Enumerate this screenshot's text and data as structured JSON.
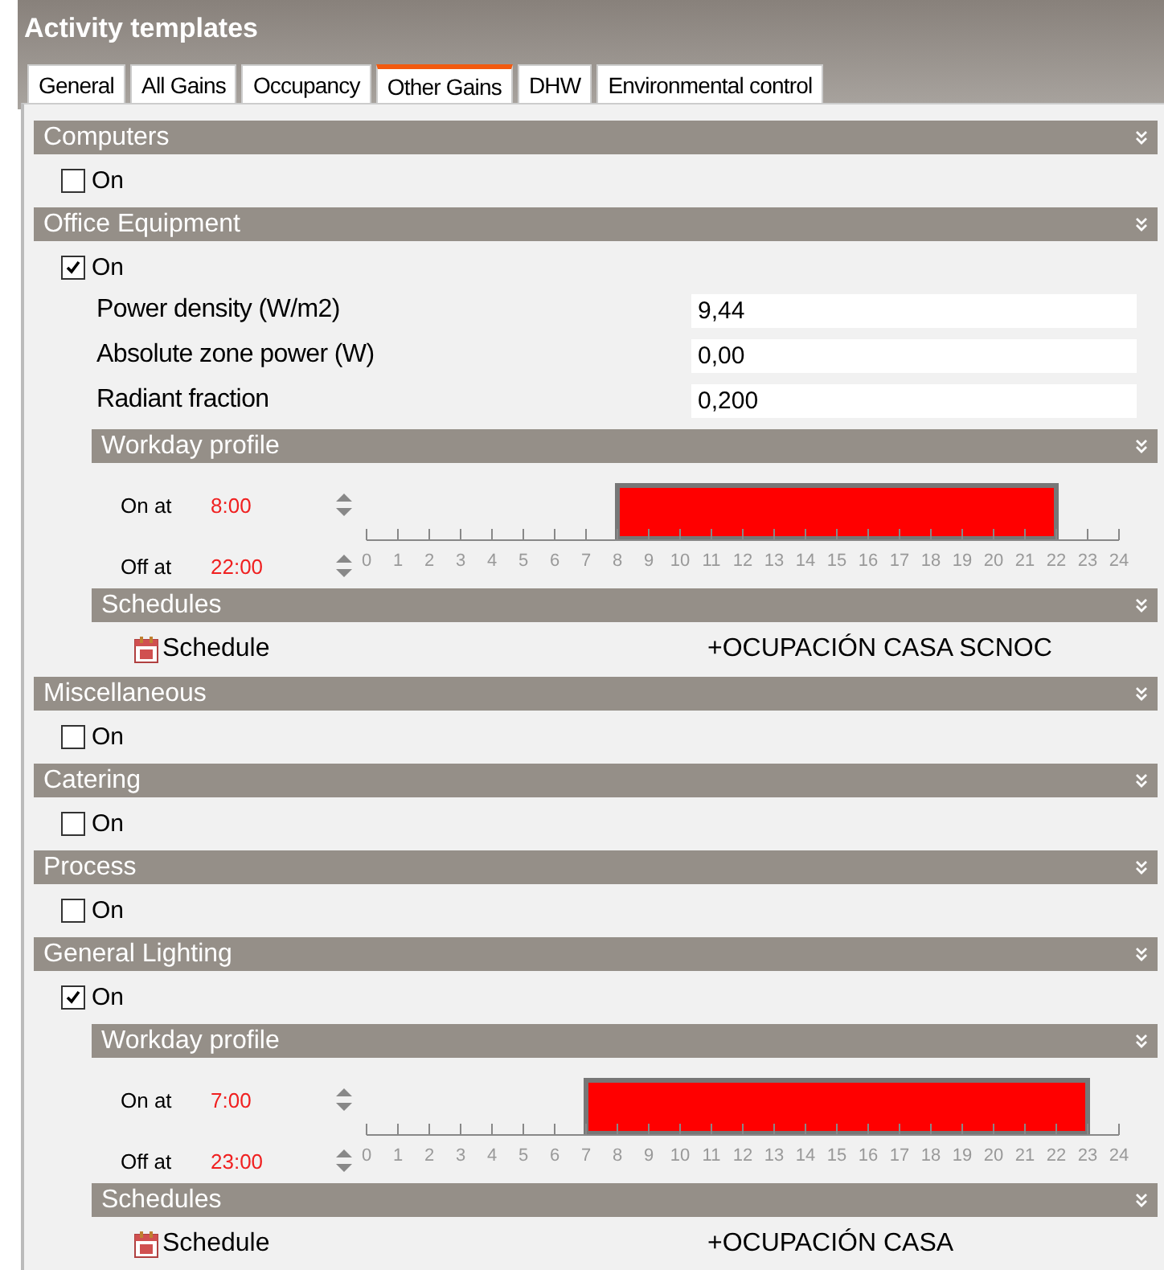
{
  "window": {
    "title": "Activity templates"
  },
  "tabs": [
    {
      "label": "General",
      "selected": false
    },
    {
      "label": "All Gains",
      "selected": false
    },
    {
      "label": "Occupancy",
      "selected": false
    },
    {
      "label": "Other Gains",
      "selected": true
    },
    {
      "label": "DHW",
      "selected": false
    },
    {
      "label": "Environmental control",
      "selected": false
    }
  ],
  "sections": [
    {
      "title": "Computers",
      "on": {
        "label": "On",
        "checked": false
      }
    },
    {
      "title": "Office Equipment",
      "on": {
        "label": "On",
        "checked": true
      },
      "fields": [
        {
          "label": "Power density (W/m2)",
          "value": "9,44"
        },
        {
          "label": "Absolute zone power (W)",
          "value": "0,00"
        },
        {
          "label": "Radiant fraction",
          "value": "0,200"
        }
      ],
      "profile": {
        "title": "Workday profile",
        "on_label": "On at",
        "on_time": "8:00",
        "off_label": "Off at",
        "off_time": "22:00",
        "hours": [
          "0",
          "1",
          "2",
          "3",
          "4",
          "5",
          "6",
          "7",
          "8",
          "9",
          "10",
          "11",
          "12",
          "13",
          "14",
          "15",
          "16",
          "17",
          "18",
          "19",
          "20",
          "21",
          "22",
          "23",
          "24"
        ]
      },
      "schedules": {
        "title": "Schedules",
        "label": "Schedule",
        "value": "+OCUPACIÓN CASA SCNOC"
      }
    },
    {
      "title": "Miscellaneous",
      "on": {
        "label": "On",
        "checked": false
      }
    },
    {
      "title": "Catering",
      "on": {
        "label": "On",
        "checked": false
      }
    },
    {
      "title": "Process",
      "on": {
        "label": "On",
        "checked": false
      }
    },
    {
      "title": "General Lighting",
      "on": {
        "label": "On",
        "checked": true
      },
      "profile": {
        "title": "Workday profile",
        "on_label": "On at",
        "on_time": "7:00",
        "off_label": "Off at",
        "off_time": "23:00",
        "hours": [
          "0",
          "1",
          "2",
          "3",
          "4",
          "5",
          "6",
          "7",
          "8",
          "9",
          "10",
          "11",
          "12",
          "13",
          "14",
          "15",
          "16",
          "17",
          "18",
          "19",
          "20",
          "21",
          "22",
          "23",
          "24"
        ]
      },
      "schedules": {
        "title": "Schedules",
        "label": "Schedule",
        "value": "+OCUPACIÓN CASA"
      }
    }
  ]
}
